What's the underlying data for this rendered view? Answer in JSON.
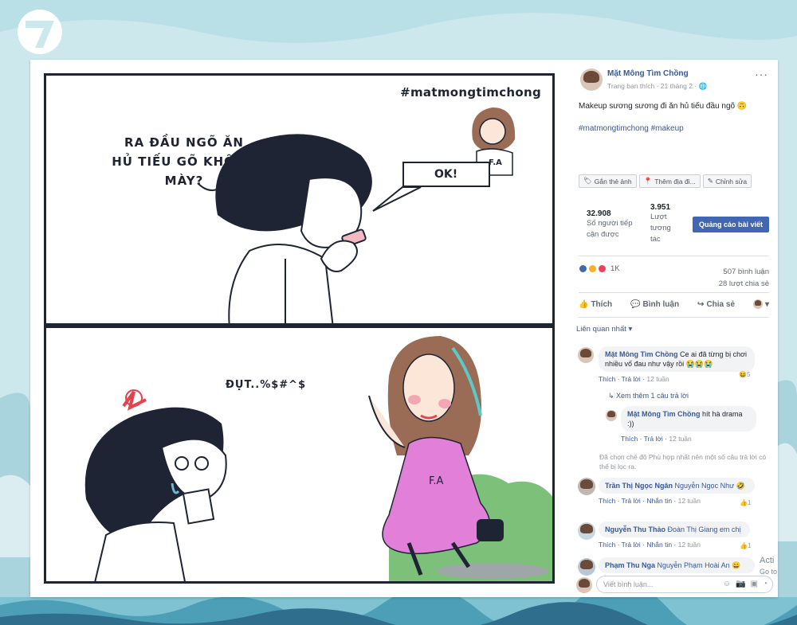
{
  "logo": {
    "icon": "seven-logo-icon"
  },
  "art": {
    "hashtag": "#matmongtimchong",
    "speech_top_line1": "RA ĐẦU NGÕ ĂN",
    "speech_top_line2": "HỦ TIẾU GÕ KHÔNG MÀY?",
    "ok_reply": "OK!",
    "fa_shirt": "F.A",
    "speech_bottom": "ĐỤT..%$#^$",
    "fa_dress": "F.A"
  },
  "post": {
    "page_name": "Mặt Mông Tìm Chồng",
    "meta": "Trang bạn thích · 21 tháng 2 ·",
    "text": "Makeup sương sương đi ăn hủ tiếu đầu ngõ 🙃",
    "tags": "#matmongtimchong #makeup",
    "tag_photo": "Gắn thẻ ảnh",
    "add_location": "Thêm địa đi...",
    "edit": "Chỉnh sửa",
    "reach_num": "32.908",
    "reach_label_1": "Số người tiếp",
    "reach_label_2": "cận được",
    "eng_num": "3.951",
    "eng_label_1": "Lượt",
    "eng_label_2": "tương",
    "eng_label_3": "tác",
    "promote": "Quảng cáo bài viết",
    "reaction_count": "1K",
    "comment_count": "507 bình luận",
    "share_count": "28 lượt chia sẻ",
    "like": "Thích",
    "comment": "Bình luận",
    "share": "Chia sẻ",
    "related": "Liên quan nhất ▾"
  },
  "comments": [
    {
      "name": "Mặt Mông Tìm Chồng",
      "text": "Ce ai đã từng bị chơi nhiều vố đau như vậy rồi 😭😭😭",
      "like": "Thích",
      "reply": "Trả lời",
      "time": "12 tuần",
      "react": "5"
    },
    {
      "more_replies": "Xem thêm 1 câu trả lời"
    },
    {
      "name": "Mặt Mông Tìm Chồng",
      "text": "hít hà drama :))",
      "like": "Thích",
      "reply": "Trả lời",
      "time": "12 tuần"
    },
    {
      "filter_note": "Đã chọn chế độ Phù hợp nhất nên một số câu trả lời có thể bị lọc ra."
    },
    {
      "name": "Trần Thị Ngọc Ngân",
      "text": "Nguyễn Ngọc Như 🤣",
      "like": "Thích",
      "reply": "Trả lời",
      "message": "Nhắn tin",
      "time": "12 tuần",
      "react": "1"
    },
    {
      "name": "Nguyễn Thu Thảo",
      "text": "Đoàn Thị Giang em chị",
      "like": "Thích",
      "reply": "Trả lời",
      "message": "Nhắn tin",
      "time": "12 tuần",
      "react": "1"
    },
    {
      "name": "Phạm Thu Nga",
      "text": "Nguyễn Phạm Hoài An 😄"
    }
  ],
  "reply_placeholder": "Viết bình luận...",
  "watermark_1": "Acti",
  "watermark_2": "Go to",
  "colors": {
    "accent": "#4267b2",
    "link": "#385898",
    "ink": "#1e2433",
    "dress": "#e27fd8"
  }
}
